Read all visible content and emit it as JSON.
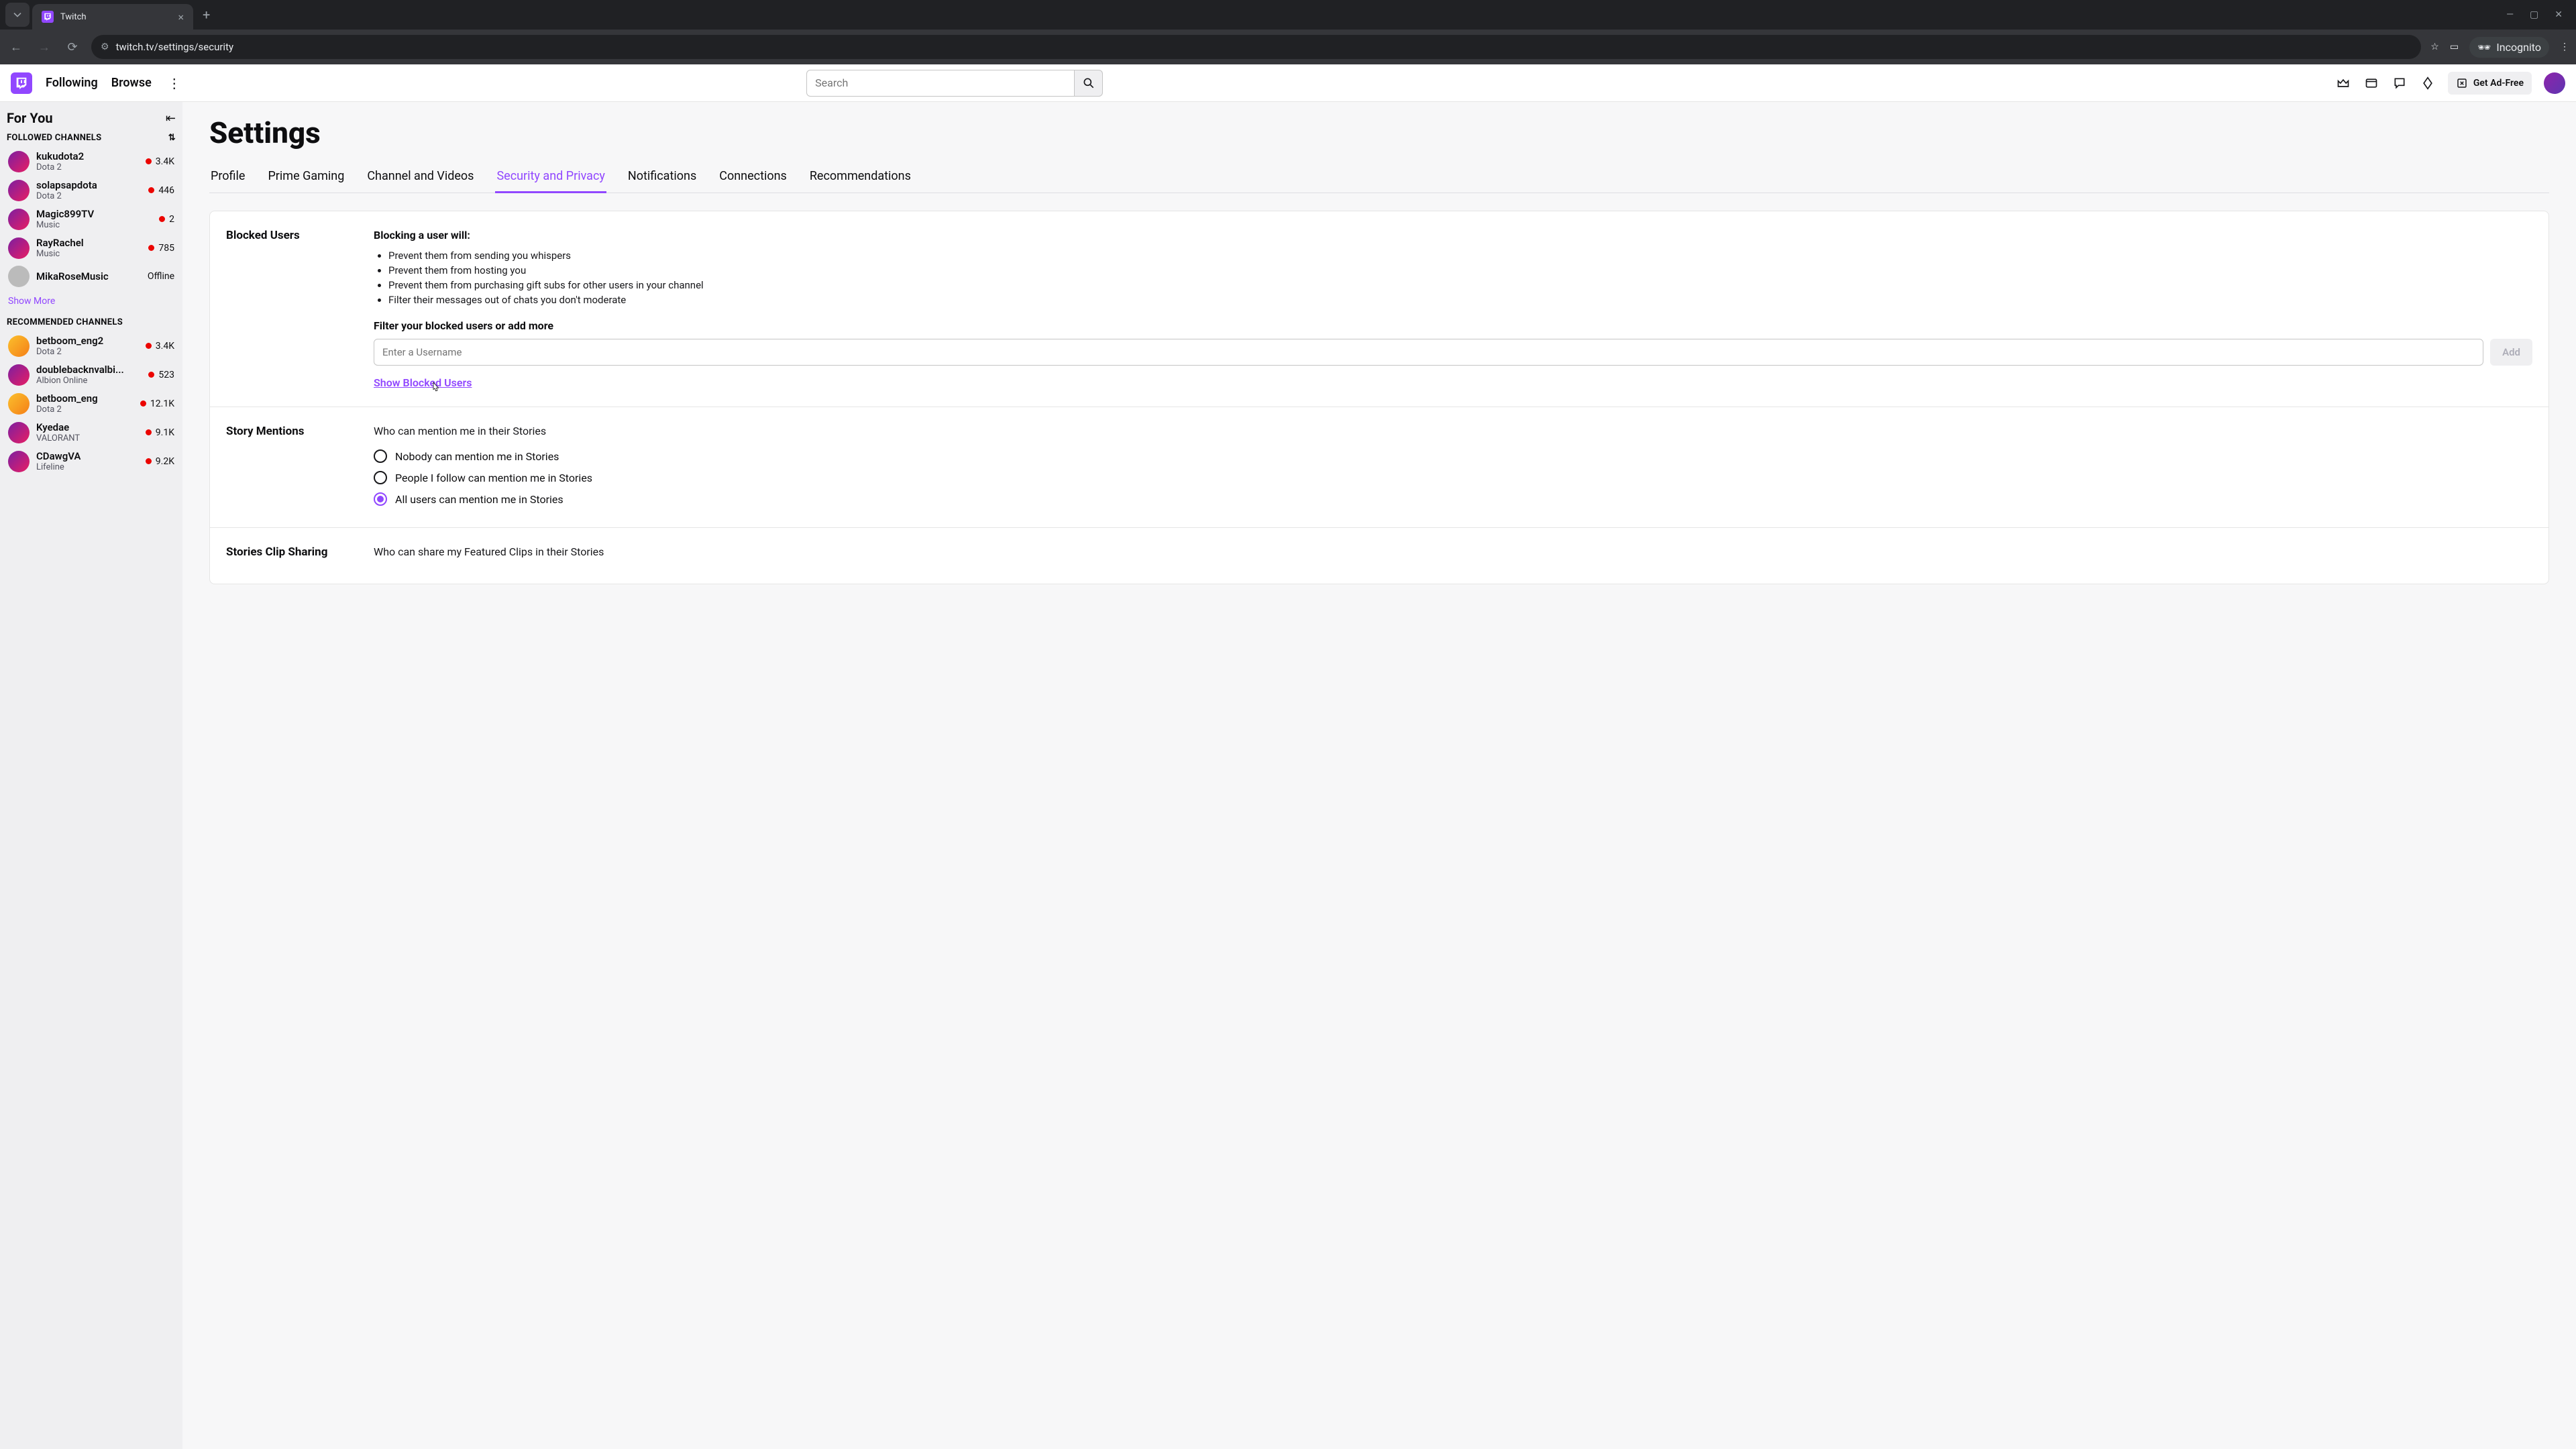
{
  "browser": {
    "tab_title": "Twitch",
    "url": "twitch.tv/settings/security",
    "incognito_label": "Incognito"
  },
  "topnav": {
    "following": "Following",
    "browse": "Browse",
    "search_placeholder": "Search",
    "adfree": "Get Ad-Free"
  },
  "sidebar": {
    "for_you": "For You",
    "followed_heading": "FOLLOWED CHANNELS",
    "followed": [
      {
        "name": "kukudota2",
        "game": "Dota 2",
        "viewers": "3.4K",
        "live": true,
        "avclass": "live"
      },
      {
        "name": "solapsapdota",
        "game": "Dota 2",
        "viewers": "446",
        "live": true,
        "avclass": "live"
      },
      {
        "name": "Magic899TV",
        "game": "Music",
        "viewers": "2",
        "live": true,
        "avclass": "live"
      },
      {
        "name": "RayRachel",
        "game": "Music",
        "viewers": "785",
        "live": true,
        "avclass": "live"
      },
      {
        "name": "MikaRoseMusic",
        "game": "",
        "viewers": "Offline",
        "live": false,
        "avclass": "off"
      }
    ],
    "show_more": "Show More",
    "recommended_heading": "RECOMMENDED CHANNELS",
    "recommended": [
      {
        "name": "betboom_eng2",
        "game": "Dota 2",
        "viewers": "3.4K",
        "live": true,
        "avclass": "y"
      },
      {
        "name": "doublebacknvalbi...",
        "game": "Albion Online",
        "viewers": "523",
        "live": true,
        "avclass": "live"
      },
      {
        "name": "betboom_eng",
        "game": "Dota 2",
        "viewers": "12.1K",
        "live": true,
        "avclass": "y"
      },
      {
        "name": "Kyedae",
        "game": "VALORANT",
        "viewers": "9.1K",
        "live": true,
        "avclass": "live"
      },
      {
        "name": "CDawgVA",
        "game": "Lifeline",
        "viewers": "9.2K",
        "live": true,
        "avclass": "live"
      }
    ]
  },
  "page": {
    "title": "Settings",
    "tabs": [
      "Profile",
      "Prime Gaming",
      "Channel and Videos",
      "Security and Privacy",
      "Notifications",
      "Connections",
      "Recommendations"
    ],
    "active_tab": 3,
    "blocked": {
      "heading": "Blocked Users",
      "lead": "Blocking a user will:",
      "bullets": [
        "Prevent them from sending you whispers",
        "Prevent them from hosting you",
        "Prevent them from purchasing gift subs for other users in your channel",
        "Filter their messages out of chats you don't moderate"
      ],
      "filter_label": "Filter your blocked users or add more",
      "input_placeholder": "Enter a Username",
      "add_btn": "Add",
      "show_link": "Show Blocked Users"
    },
    "story_mentions": {
      "heading": "Story Mentions",
      "sub": "Who can mention me in their Stories",
      "options": [
        "Nobody can mention me in Stories",
        "People I follow can mention me in Stories",
        "All users can mention me in Stories"
      ],
      "selected": 2
    },
    "clip_sharing": {
      "heading": "Stories Clip Sharing",
      "sub": "Who can share my Featured Clips in their Stories"
    }
  }
}
